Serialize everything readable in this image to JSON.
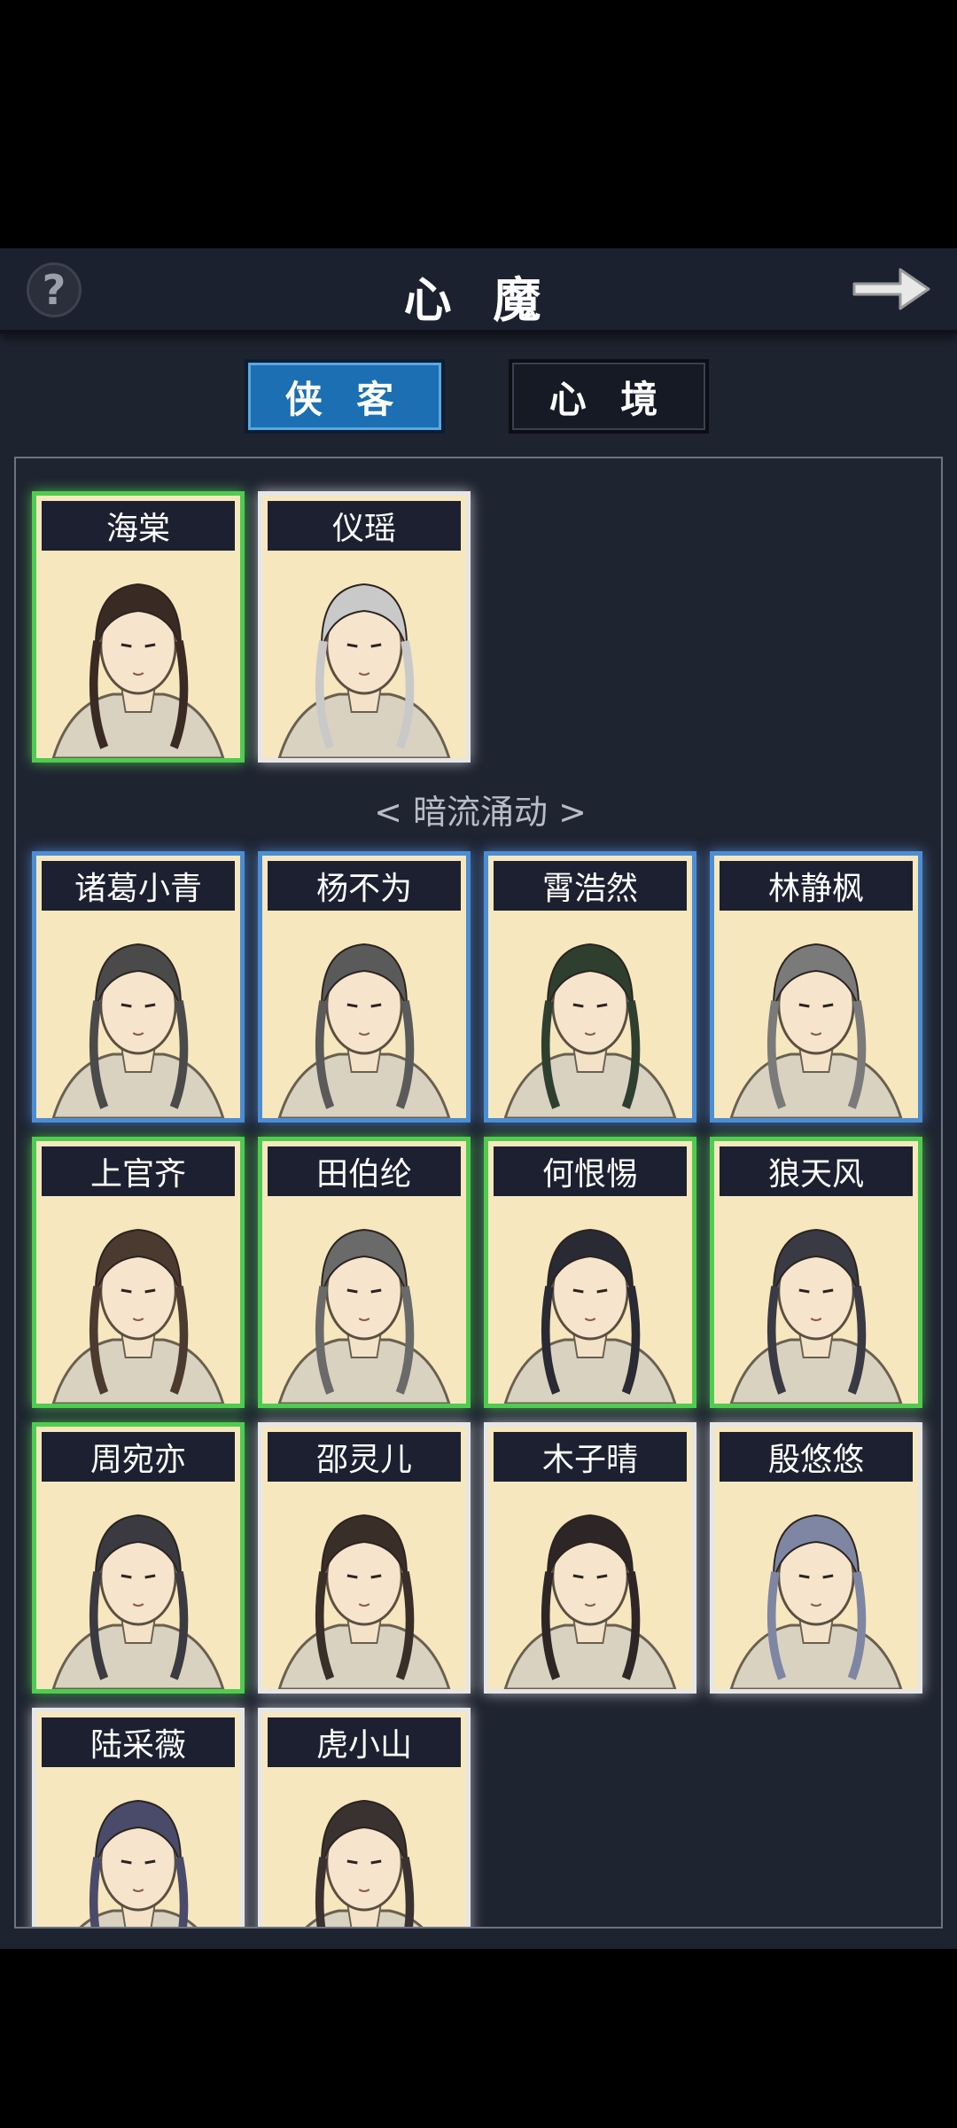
{
  "header": {
    "title": "心 魔",
    "help_label": "?"
  },
  "tabs": [
    {
      "label": "侠 客",
      "active": true
    },
    {
      "label": "心 境",
      "active": false
    }
  ],
  "section_label": "< 暗流涌动 >",
  "top_heroes": [
    {
      "name": "海棠",
      "rarity": "green",
      "hair": "#3a2a24"
    },
    {
      "name": "仪瑶",
      "rarity": "white",
      "hair": "#c9c9c9"
    }
  ],
  "heroes": [
    {
      "name": "诸葛小青",
      "rarity": "blue",
      "hair": "#4a4a4a"
    },
    {
      "name": "杨不为",
      "rarity": "blue",
      "hair": "#5a5a5a"
    },
    {
      "name": "霄浩然",
      "rarity": "blue",
      "hair": "#2f3f2f"
    },
    {
      "name": "林静枫",
      "rarity": "blue",
      "hair": "#7a7a7a"
    },
    {
      "name": "上官齐",
      "rarity": "green",
      "hair": "#4a3a30"
    },
    {
      "name": "田伯纶",
      "rarity": "green",
      "hair": "#6a6a6a"
    },
    {
      "name": "何恨惕",
      "rarity": "green",
      "hair": "#2a2a34"
    },
    {
      "name": "狼天风",
      "rarity": "green",
      "hair": "#3a3a44"
    },
    {
      "name": "周宛亦",
      "rarity": "green",
      "hair": "#3a3a40"
    },
    {
      "name": "邵灵儿",
      "rarity": "white",
      "hair": "#3a2e28"
    },
    {
      "name": "木子晴",
      "rarity": "white",
      "hair": "#2e2626"
    },
    {
      "name": "殷悠悠",
      "rarity": "white",
      "hair": "#7f86a4"
    },
    {
      "name": "陆采薇",
      "rarity": "white",
      "hair": "#4a4a6a"
    },
    {
      "name": "虎小山",
      "rarity": "white",
      "hair": "#3a3230"
    }
  ],
  "colors": {
    "accent": "#1b6fb2",
    "card_bg": "#f6e7be",
    "green": "#4fcc4f",
    "blue": "#4c8ed4",
    "white": "#e6e6e6"
  }
}
